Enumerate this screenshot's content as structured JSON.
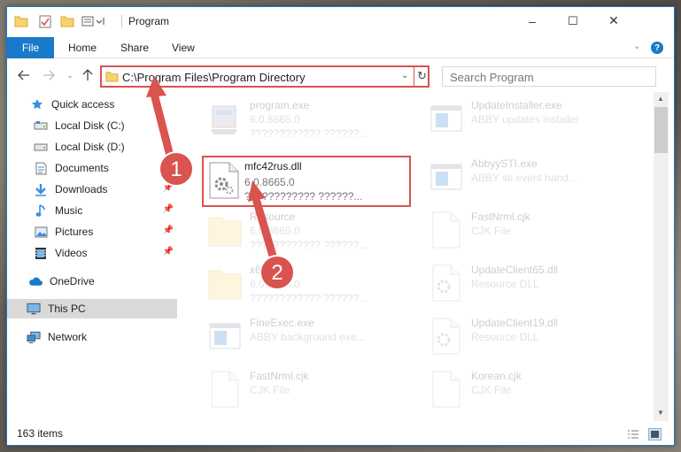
{
  "window": {
    "title": "Program",
    "controls": {
      "minimize": "–",
      "maximize": "☐",
      "close": "✕"
    }
  },
  "ribbon": {
    "tabs": [
      "File",
      "Home",
      "Share",
      "View"
    ],
    "help": "?"
  },
  "address": {
    "path": "C:\\Program Files\\Program Directory",
    "search_placeholder": "Search Program"
  },
  "sidebar": {
    "items": [
      {
        "label": "Quick access",
        "icon": "star-icon"
      },
      {
        "label": "Local Disk (C:)",
        "icon": "drive-icon"
      },
      {
        "label": "Local Disk (D:)",
        "icon": "drive-icon"
      },
      {
        "label": "Documents",
        "icon": "documents-icon"
      },
      {
        "label": "Downloads",
        "icon": "download-icon"
      },
      {
        "label": "Music",
        "icon": "music-icon"
      },
      {
        "label": "Pictures",
        "icon": "pictures-icon"
      },
      {
        "label": "Videos",
        "icon": "videos-icon"
      },
      {
        "label": "OneDrive",
        "icon": "cloud-icon"
      },
      {
        "label": "This PC",
        "icon": "computer-icon"
      },
      {
        "label": "Network",
        "icon": "network-icon"
      }
    ]
  },
  "files": {
    "left": [
      {
        "name": "program.exe",
        "line1": "6.0.8665.0",
        "line2": "???????????? ??????..."
      },
      {
        "name": "mfc42rus.dll",
        "line1": "6.0.8665.0",
        "line2": "???????????? ??????..."
      },
      {
        "name": "Resource",
        "line1": "6.0.8665.0",
        "line2": "???????????? ??????..."
      },
      {
        "name": "x64",
        "line1": "6.0.8665.0",
        "line2": "???????????? ??????..."
      },
      {
        "name": "FineExec.exe",
        "line1": "ABBY background exe...",
        "line2": ""
      },
      {
        "name": "FastNrml.cjk",
        "line1": "CJK File",
        "line2": ""
      }
    ],
    "right": [
      {
        "name": "UpdateInstaller.exe",
        "line1": "ABBY updates installer",
        "line2": ""
      },
      {
        "name": "AbbyySTI.exe",
        "line1": "ABBY sti event hand...",
        "line2": ""
      },
      {
        "name": "FastNrml.cjk",
        "line1": "CJK File",
        "line2": ""
      },
      {
        "name": "UpdateClient65.dll",
        "line1": "Resource DLL",
        "line2": ""
      },
      {
        "name": "UpdateClient19.dll",
        "line1": "Resource DLL",
        "line2": ""
      },
      {
        "name": "Korean.cjk",
        "line1": "CJK File",
        "line2": ""
      }
    ]
  },
  "status": {
    "count": "163 items"
  },
  "annotations": {
    "step1": "1",
    "step2": "2"
  },
  "colors": {
    "accent": "#1979ca",
    "annotation": "#d9534f"
  }
}
